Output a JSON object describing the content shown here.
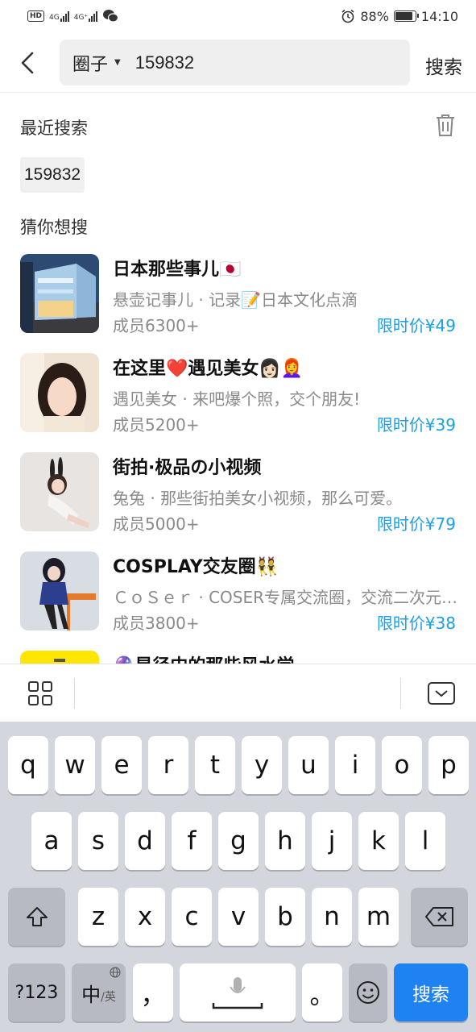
{
  "status_bar": {
    "left": {
      "hd": "HD",
      "net1": "4G",
      "net2": "4G⁺",
      "app_icon": "wechat-icon"
    },
    "right": {
      "alarm_icon": "alarm-icon",
      "battery_text": "88%",
      "battery_level": 0.88,
      "time": "14:10"
    }
  },
  "header": {
    "scope_label": "圈子",
    "query": "159832",
    "search_button": "搜索"
  },
  "recent": {
    "title": "最近搜索",
    "items": [
      "159832"
    ]
  },
  "suggest": {
    "title": "猜你想搜",
    "items": [
      {
        "title": "日本那些事儿🇯🇵",
        "desc": "悬壶记事儿 · 记录📝日本文化点滴",
        "members": "成员6300+",
        "price": "限时价¥49"
      },
      {
        "title": "在这里❤️遇见美女👩🏻👩‍🦰",
        "desc": "遇见美女 · 来吧爆个照，交个朋友!",
        "members": "成员5200+",
        "price": "限时价¥39"
      },
      {
        "title": "街拍·极品の小视频",
        "desc": "兔兔 · 那些街拍美女小视频，那么可爱。",
        "members": "成员5000+",
        "price": "限时价¥79"
      },
      {
        "title": "COSPLAY交友圈👯",
        "desc": "ＣｏＳｅｒ · COSER专属交流圈，交流二次元文化",
        "members": "成员3800+",
        "price": "限时价¥38"
      },
      {
        "title": "🔮星径中的那些风水学",
        "desc": "",
        "members": "",
        "price": ""
      }
    ]
  },
  "keyboard": {
    "row1": [
      "q",
      "w",
      "e",
      "r",
      "t",
      "y",
      "u",
      "i",
      "o",
      "p"
    ],
    "row2": [
      "a",
      "s",
      "d",
      "f",
      "g",
      "h",
      "j",
      "k",
      "l"
    ],
    "row3": [
      "z",
      "x",
      "c",
      "v",
      "b",
      "n",
      "m"
    ],
    "shift_icon": "shift-icon",
    "backspace_icon": "backspace-icon",
    "num_key": "?123",
    "lang_key_main": "中",
    "lang_key_sub": "/英",
    "comma_key": "，",
    "space_icon": "microphone-icon",
    "period_key": "。",
    "emoji_icon": "emoji-icon",
    "enter_key": "搜索",
    "accent": "#1e82f2"
  }
}
